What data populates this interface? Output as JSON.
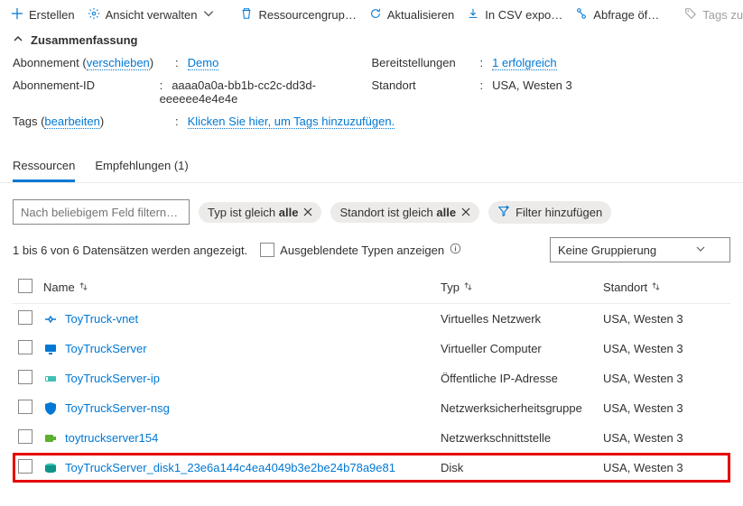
{
  "toolbar": {
    "create": "Erstellen",
    "manage_view": "Ansicht verwalten",
    "resource_group": "Ressourcengrup…",
    "refresh": "Aktualisieren",
    "export_csv": "In CSV expo…",
    "open_query": "Abfrage öf…",
    "assign_tags": "Tags zu…"
  },
  "summary": {
    "title": "Zusammenfassung",
    "subscription_label": "Abonnement",
    "subscription_move": "verschieben",
    "subscription_value": "Demo",
    "subscription_id_label": "Abonnement-ID",
    "subscription_id_value": "aaaa0a0a-bb1b-cc2c-dd3d-eeeeee4e4e4e",
    "tags_label": "Tags",
    "tags_edit": "bearbeiten",
    "tags_value": "Klicken Sie hier, um Tags hinzuzufügen.",
    "deployments_label": "Bereitstellungen",
    "deployments_value": "1 erfolgreich",
    "location_label": "Standort",
    "location_value": "USA, Westen 3"
  },
  "tabs": {
    "resources": "Ressourcen",
    "recommendations": "Empfehlungen (1)"
  },
  "filters": {
    "placeholder": "Nach beliebigem Feld filtern…",
    "type_prefix": "Typ ist gleich ",
    "type_value": "alle",
    "location_prefix": "Standort ist gleich ",
    "location_value": "alle",
    "add": "Filter hinzufügen"
  },
  "status": {
    "count": "1 bis 6 von 6 Datensätzen werden angezeigt.",
    "show_hidden": "Ausgeblendete Typen anzeigen",
    "group_by": "Keine Gruppierung"
  },
  "columns": {
    "name": "Name",
    "type": "Typ",
    "location": "Standort"
  },
  "rows": [
    {
      "name": "ToyTruck-vnet",
      "type": "Virtuelles Netzwerk",
      "location": "USA, Westen 3",
      "icon": "vnet"
    },
    {
      "name": "ToyTruckServer",
      "type": "Virtueller Computer",
      "location": "USA, Westen 3",
      "icon": "vm"
    },
    {
      "name": "ToyTruckServer-ip",
      "type": "Öffentliche IP-Adresse",
      "location": "USA, Westen 3",
      "icon": "ip"
    },
    {
      "name": "ToyTruckServer-nsg",
      "type": "Netzwerksicherheitsgruppe",
      "location": "USA, Westen 3",
      "icon": "nsg"
    },
    {
      "name": "toytruckserver154",
      "type": "Netzwerkschnittstelle",
      "location": "USA, Westen 3",
      "icon": "nic"
    },
    {
      "name": "ToyTruckServer_disk1_23e6a144c4ea4049b3e2be24b78a9e81",
      "type": "Disk",
      "location": "USA, Westen 3",
      "icon": "disk",
      "highlight": true
    }
  ]
}
